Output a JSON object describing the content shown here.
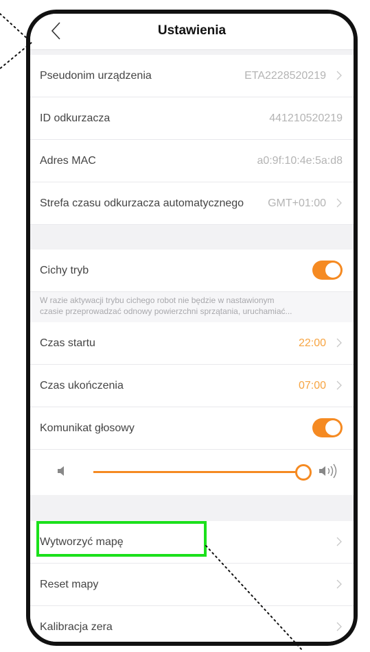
{
  "header": {
    "title": "Ustawienia"
  },
  "device": {
    "nickname_label": "Pseudonim urządzenia",
    "nickname_value": "ETA2228520219",
    "id_label": "ID odkurzacza",
    "id_value": "441210520219",
    "mac_label": "Adres MAC",
    "mac_value": "a0:9f:10:4e:5a:d8",
    "timezone_label": "Strefa czasu odkurzacza automatycznego",
    "timezone_value": "GMT+01:00"
  },
  "quiet": {
    "label": "Cichy tryb",
    "enabled": true,
    "note_line1": "W razie aktywacji trybu cichego robot nie będzie w nastawionym",
    "note_line2": "czasie przeprowadzać odnowy powierzchni sprzątania, uruchamiać...",
    "start_label": "Czas startu",
    "start_value": "22:00",
    "end_label": "Czas ukończenia",
    "end_value": "07:00"
  },
  "voice": {
    "label": "Komunikat głosowy",
    "enabled": true,
    "volume_fraction": 1.0
  },
  "map": {
    "create_label": "Wytworzyć mapę",
    "reset_label": "Reset mapy",
    "calibrate_label": "Kalibracja zera"
  },
  "colors": {
    "accent": "#f58a22",
    "highlight": "#1be01b"
  }
}
